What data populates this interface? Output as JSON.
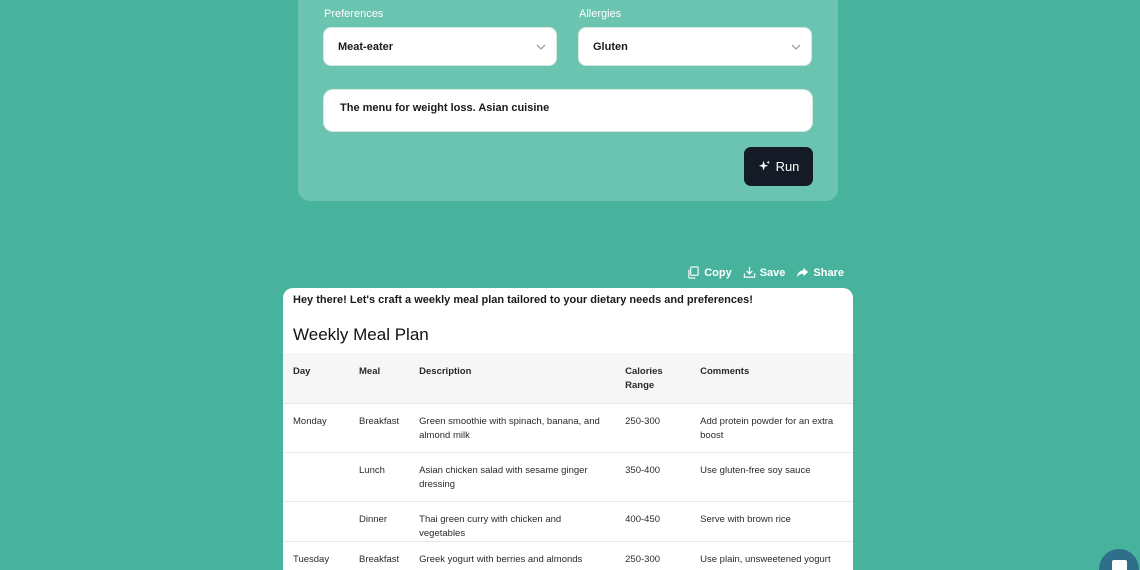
{
  "form": {
    "preferences_label": "Preferences",
    "preferences_value": "Meat-eater",
    "allergies_label": "Allergies",
    "allergies_value": "Gluten",
    "prompt_value": "The menu for weight loss. Asian cuisine",
    "run_label": "Run"
  },
  "toolbar": {
    "copy_label": "Copy",
    "save_label": "Save",
    "share_label": "Share"
  },
  "result": {
    "intro": "Hey there! Let's craft a weekly meal plan tailored to your dietary needs and preferences!",
    "title": "Weekly Meal Plan",
    "columns": [
      "Day",
      "Meal",
      "Description",
      "Calories Range",
      "Comments"
    ],
    "rows": [
      {
        "day": "Monday",
        "meal": "Breakfast",
        "description": "Green smoothie with spinach, banana, and almond milk",
        "calories": "250-300",
        "comments": "Add protein powder for an extra boost"
      },
      {
        "day": "",
        "meal": "Lunch",
        "description": "Asian chicken salad with sesame ginger dressing",
        "calories": "350-400",
        "comments": "Use gluten-free soy sauce"
      },
      {
        "day": "",
        "meal": "Dinner",
        "description": "Thai green curry with chicken and vegetables",
        "calories": "400-450",
        "comments": "Serve with brown rice"
      },
      {
        "day": "Tuesday",
        "meal": "Breakfast",
        "description": "Greek yogurt with berries and almonds",
        "calories": "250-300",
        "comments": "Use plain, unsweetened yogurt"
      }
    ]
  },
  "colors": {
    "background": "#47b39c",
    "form_card": "#6bc4b0",
    "run_button": "#141b27"
  }
}
